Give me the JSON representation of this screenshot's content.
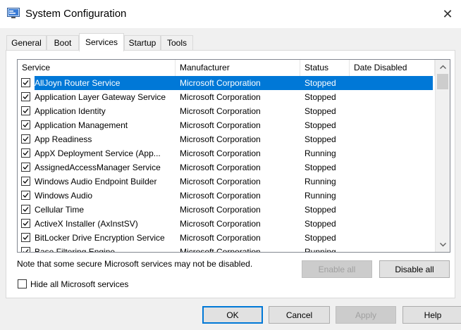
{
  "window": {
    "title": "System Configuration",
    "close_glyph": "✕"
  },
  "tabs": [
    {
      "label": "General",
      "active": false
    },
    {
      "label": "Boot",
      "active": false
    },
    {
      "label": "Services",
      "active": true
    },
    {
      "label": "Startup",
      "active": false
    },
    {
      "label": "Tools",
      "active": false
    }
  ],
  "services_table": {
    "columns": [
      "Service",
      "Manufacturer",
      "Status",
      "Date Disabled"
    ],
    "rows": [
      {
        "checked": true,
        "service": "AllJoyn Router Service",
        "manufacturer": "Microsoft Corporation",
        "status": "Stopped",
        "date_disabled": "",
        "selected": true
      },
      {
        "checked": true,
        "service": "Application Layer Gateway Service",
        "manufacturer": "Microsoft Corporation",
        "status": "Stopped",
        "date_disabled": ""
      },
      {
        "checked": true,
        "service": "Application Identity",
        "manufacturer": "Microsoft Corporation",
        "status": "Stopped",
        "date_disabled": ""
      },
      {
        "checked": true,
        "service": "Application Management",
        "manufacturer": "Microsoft Corporation",
        "status": "Stopped",
        "date_disabled": ""
      },
      {
        "checked": true,
        "service": "App Readiness",
        "manufacturer": "Microsoft Corporation",
        "status": "Stopped",
        "date_disabled": ""
      },
      {
        "checked": true,
        "service": "AppX Deployment Service (App...",
        "manufacturer": "Microsoft Corporation",
        "status": "Running",
        "date_disabled": ""
      },
      {
        "checked": true,
        "service": "AssignedAccessManager Service",
        "manufacturer": "Microsoft Corporation",
        "status": "Stopped",
        "date_disabled": ""
      },
      {
        "checked": true,
        "service": "Windows Audio Endpoint Builder",
        "manufacturer": "Microsoft Corporation",
        "status": "Running",
        "date_disabled": ""
      },
      {
        "checked": true,
        "service": "Windows Audio",
        "manufacturer": "Microsoft Corporation",
        "status": "Running",
        "date_disabled": ""
      },
      {
        "checked": true,
        "service": "Cellular Time",
        "manufacturer": "Microsoft Corporation",
        "status": "Stopped",
        "date_disabled": ""
      },
      {
        "checked": true,
        "service": "ActiveX Installer (AxInstSV)",
        "manufacturer": "Microsoft Corporation",
        "status": "Stopped",
        "date_disabled": ""
      },
      {
        "checked": true,
        "service": "BitLocker Drive Encryption Service",
        "manufacturer": "Microsoft Corporation",
        "status": "Stopped",
        "date_disabled": ""
      },
      {
        "checked": true,
        "service": "Base Filtering Engine",
        "manufacturer": "Microsoft Corporation",
        "status": "Running",
        "date_disabled": ""
      }
    ]
  },
  "note": "Note that some secure Microsoft services may not be disabled.",
  "buttons": {
    "enable_all": "Enable all",
    "disable_all": "Disable all",
    "ok": "OK",
    "cancel": "Cancel",
    "apply": "Apply",
    "help": "Help"
  },
  "hide_ms_services": {
    "label": "Hide all Microsoft services",
    "checked": false
  },
  "icons": {
    "app": "system-config-icon",
    "close": "close-icon",
    "scroll_up": "chevron-up-icon",
    "scroll_down": "chevron-down-icon",
    "check": "checkmark-icon"
  },
  "colors": {
    "selection": "#0078d7",
    "default_button_border": "#0078d7",
    "disabled_button_text": "#a0a0a0"
  }
}
